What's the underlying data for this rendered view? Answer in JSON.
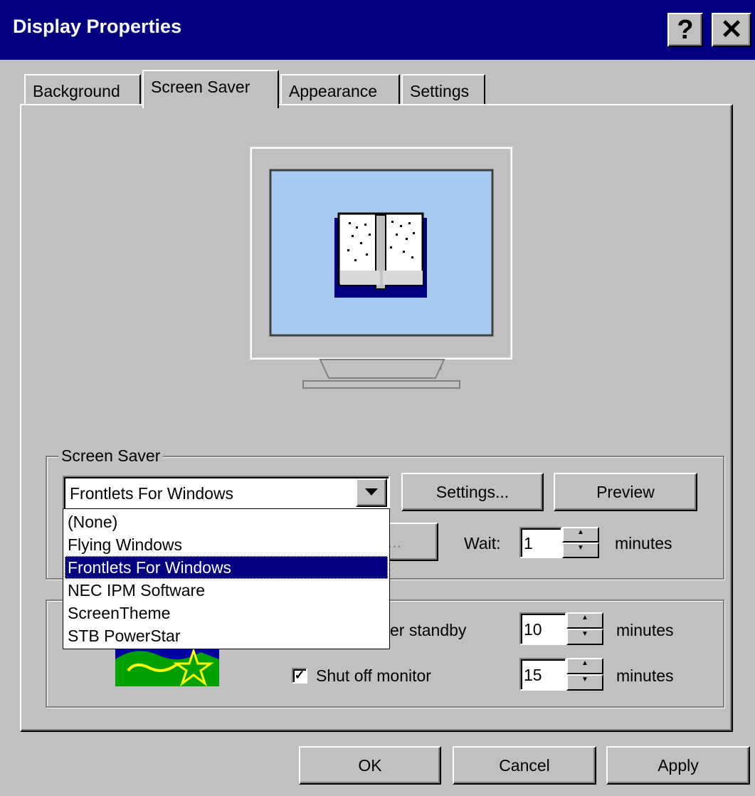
{
  "window": {
    "title": "Display Properties",
    "help_label": "?",
    "close_label": "✕"
  },
  "tabs": [
    {
      "label": "Background",
      "active": false
    },
    {
      "label": "Screen Saver",
      "active": true
    },
    {
      "label": "Appearance",
      "active": false
    },
    {
      "label": "Settings",
      "active": false
    }
  ],
  "screensaver": {
    "group_label": "Screen Saver",
    "selected": "Frontlets For Windows",
    "settings_button": "Settings...",
    "preview_button": "Preview",
    "password_button": "e...",
    "wait_label": "Wait:",
    "wait_value": "1",
    "wait_unit": "minutes",
    "options": [
      "(None)",
      "Flying Windows",
      "Frontlets For Windows",
      "NEC IPM Software",
      "ScreenTheme",
      "STB PowerStar"
    ],
    "highlighted_index": 2
  },
  "energy": {
    "standby_label_fragment": "er standby",
    "standby_value": "10",
    "standby_unit": "minutes",
    "shutoff_label": "Shut off monitor",
    "shutoff_checked": true,
    "shutoff_value": "15",
    "shutoff_unit": "minutes",
    "logo_name": "energy-star-logo"
  },
  "footer": {
    "ok_label": "OK",
    "cancel_label": "Cancel",
    "apply_label": "Apply"
  },
  "colors": {
    "titlebar": "#000080",
    "face": "#c0c0c0",
    "screen": "#a6caf0",
    "selection": "#000080"
  }
}
